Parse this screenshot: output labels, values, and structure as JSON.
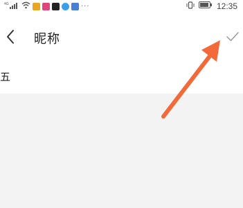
{
  "status_bar": {
    "signal_label": "4G",
    "time": "12:35",
    "more_dots": "···"
  },
  "header": {
    "title": "昵称"
  },
  "nickname_field": {
    "value": "五"
  },
  "colors": {
    "arrow": "#f26a3a",
    "content_bg": "#f3f3f3",
    "icon_gray": "#555555"
  }
}
